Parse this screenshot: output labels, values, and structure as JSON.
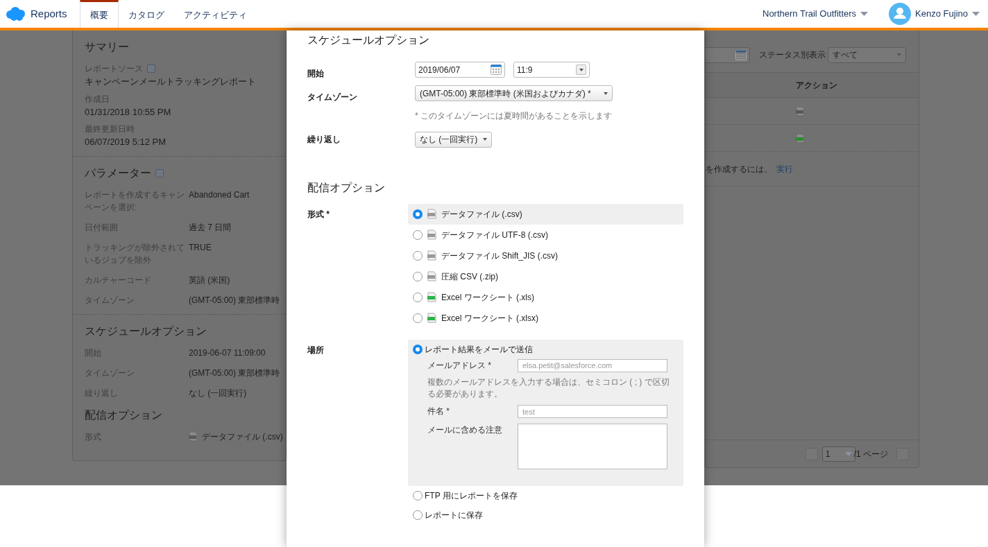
{
  "header": {
    "app_name": "Reports",
    "org": "Northern Trail Outfitters",
    "user": "Kenzo Fujino",
    "tabs": [
      {
        "label": "概要",
        "selected": true
      },
      {
        "label": "カタログ",
        "selected": false
      },
      {
        "label": "アクティビティ",
        "selected": false
      }
    ]
  },
  "summary": {
    "title": "サマリー",
    "fields": [
      {
        "label": "レポートソース",
        "value": "キャンペーンメールトラッキングレポート",
        "help": true
      },
      {
        "label": "作成日",
        "value": "01/31/2018 10:55 PM",
        "help": false
      },
      {
        "label": "最終更新日時",
        "value": "06/07/2019 5:12 PM",
        "help": false
      }
    ]
  },
  "parameters": {
    "title": "パラメーター",
    "rows": [
      {
        "label": "レポートを作成するキャンペーンを選択:",
        "value": "Abandoned Cart"
      },
      {
        "label": "日付範囲",
        "value": "過去 7 日間"
      },
      {
        "label": "トラッキングが除外されているジョブを除外",
        "value": "TRUE"
      },
      {
        "label": "カルチャーコード",
        "value": "英語 (米国)"
      },
      {
        "label": "タイムゾーン",
        "value": "(GMT-05:00) 東部標準時"
      }
    ]
  },
  "schedule_summary": {
    "title": "スケジュールオプション",
    "rows": [
      {
        "label": "開始",
        "value": "2019-06-07 11:09:00"
      },
      {
        "label": "タイムゾーン",
        "value": "(GMT-05:00) 東部標準時"
      },
      {
        "label": "繰り返し",
        "value": "なし (一回実行)"
      }
    ]
  },
  "delivery_summary": {
    "title": "配信オプション",
    "label": "形式",
    "value": "データファイル (.csv)"
  },
  "history": {
    "status_label": "ステータス別表示",
    "status_value": "すべて",
    "action_header": "アクション",
    "rows": [
      {
        "kind": "csv"
      },
      {
        "kind": "excel"
      }
    ],
    "empty_text": "を作成するには、",
    "empty_link": "実行",
    "page": "1",
    "page_total": "/1 ページ"
  },
  "modal": {
    "schedule": {
      "title": "スケジュールオプション",
      "start_label": "開始",
      "start_date": "2019/06/07",
      "start_time": "11:9",
      "timezone_label": "タイムゾーン",
      "timezone": "(GMT-05:00) 東部標準時 (米国およびカナダ) *",
      "timezone_note": "* このタイムゾーンには夏時間があることを示します",
      "repeat_label": "繰り返し",
      "repeat": "なし (一回実行)"
    },
    "delivery": {
      "title": "配信オプション",
      "format_label": "形式 *",
      "formats": [
        {
          "label": "データファイル (.csv)",
          "kind": "csv",
          "selected": true
        },
        {
          "label": "データファイル UTF-8 (.csv)",
          "kind": "csv",
          "selected": false
        },
        {
          "label": "データファイル Shift_JIS (.csv)",
          "kind": "csv",
          "selected": false
        },
        {
          "label": "圧縮 CSV (.zip)",
          "kind": "csv",
          "selected": false
        },
        {
          "label": "Excel ワークシート (.xls)",
          "kind": "excel",
          "selected": false
        },
        {
          "label": "Excel ワークシート (.xlsx)",
          "kind": "excel",
          "selected": false
        }
      ],
      "location_label": "場所",
      "locations": [
        {
          "label": "レポート結果をメールで送信",
          "kind": "email",
          "selected": true
        },
        {
          "label": "FTP 用にレポートを保存",
          "kind": "plain",
          "selected": false
        },
        {
          "label": "レポートに保存",
          "kind": "plain",
          "selected": false
        }
      ],
      "email": {
        "address_label": "メールアドレス *",
        "address_placeholder": "elsa.petit@salesforce.com",
        "hint": "複数のメールアドレスを入力する場合は、セミコロン ( ; ) で区切る必要があります。",
        "subject_label": "件名 *",
        "subject_placeholder": "test",
        "notes_label": "メールに含める注意"
      }
    }
  }
}
